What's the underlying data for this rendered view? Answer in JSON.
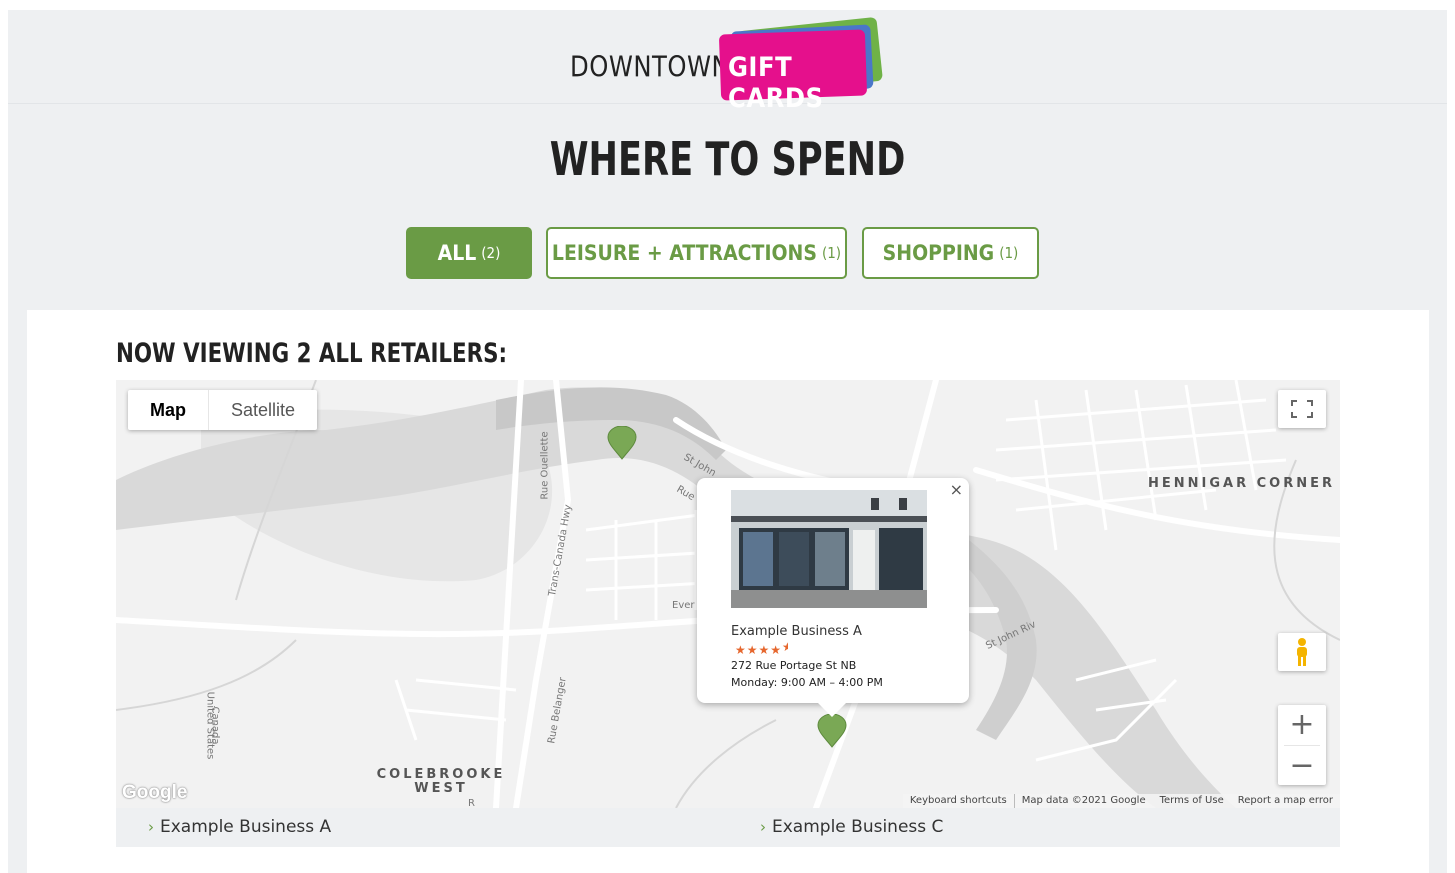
{
  "brand": {
    "word_left": "DOWNTOWN",
    "word_right": "GIFT CARDS",
    "colors": {
      "pink": "#e5108c",
      "blue": "#4a77c9",
      "green": "#6fb247"
    }
  },
  "page_title": "WHERE TO SPEND",
  "filters": [
    {
      "label": "ALL",
      "count": "(2)",
      "active": true
    },
    {
      "label": "LEISURE + ATTRACTIONS",
      "count": "(1)",
      "active": false
    },
    {
      "label": "SHOPPING",
      "count": "(1)",
      "active": false
    }
  ],
  "accent_color": "#6a9b45",
  "viewing_title": "NOW VIEWING 2 ALL RETAILERS:",
  "map": {
    "type_options": [
      "Map",
      "Satellite"
    ],
    "selected_type": "Map",
    "places": [
      "HENNIGAR CORNER",
      "COLEBROOKE WEST"
    ],
    "roads": [
      "Rue Ouellette",
      "Trans-Canada Hwy",
      "Rue Belanger",
      "St John Riv",
      "St John",
      "Rue",
      "Ever",
      "Canada",
      "United States",
      "R"
    ],
    "icons": [
      "fullscreen-icon",
      "pegman-icon",
      "zoom-in-icon",
      "zoom-out-icon",
      "map-pin-icon",
      "close-icon"
    ],
    "zoom_in": "+",
    "zoom_out": "−",
    "close": "×",
    "google_logo": "Google",
    "attribution": [
      "Keyboard shortcuts",
      "Map data ©2021 Google",
      "Terms of Use",
      "Report a map error"
    ],
    "info_window": {
      "name": "Example Business A",
      "rating": 4.5,
      "stars": "★★★★",
      "half_star": "★",
      "address": "272 Rue Portage St NB",
      "hours": "Monday: 9:00 AM – 4:00 PM"
    }
  },
  "businesses": [
    "Example Business A",
    "Example Business C"
  ],
  "chevron": "›"
}
